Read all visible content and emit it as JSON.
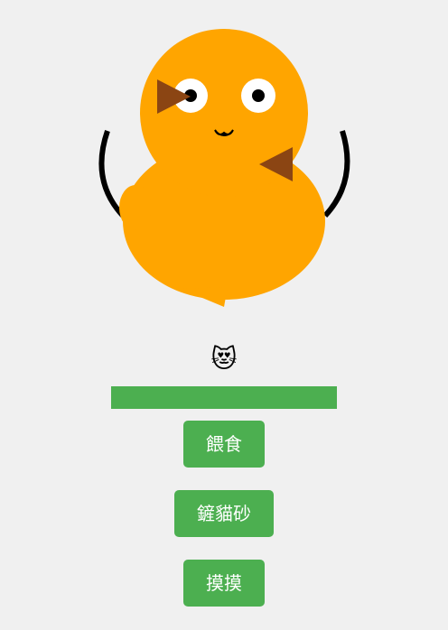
{
  "pet": {
    "mood_emoji": "😻",
    "status_level_percent": 100,
    "colors": {
      "body": "#ffa500",
      "ears": "#8b4513",
      "eye_white": "#ffffff",
      "pupil": "#000000",
      "whisker": "#000000",
      "status_bar": "#4caf50"
    }
  },
  "actions": {
    "feed_label": "餵食",
    "litter_label": "鏟貓砂",
    "pet_label": "摸摸"
  }
}
